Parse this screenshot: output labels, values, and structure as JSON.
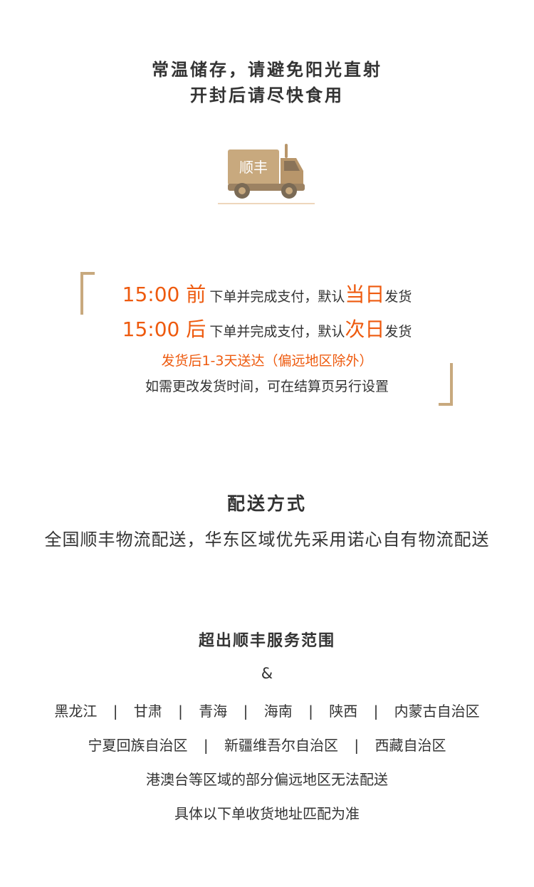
{
  "storage": {
    "line1": "常温储存，请避免阳光直射",
    "line2": "开封后请尽快食用"
  },
  "truck": {
    "label": "顺丰",
    "colors": {
      "body": "#c8a97e",
      "wheels": "#7a6a55",
      "line": "#e8c9a6"
    }
  },
  "shipping": {
    "before": {
      "time": "15:00 前",
      "text": "下单并完成支付，默认",
      "highlight": "当日",
      "suffix": "发货"
    },
    "after": {
      "time": "15:00 后",
      "text": "下单并完成支付，默认",
      "highlight": "次日",
      "suffix": "发货"
    },
    "delivery_range": "发货后1-3天送达（偏远地区除外）",
    "change_note": "如需更改发货时间，可在结算页另行设置"
  },
  "method": {
    "title": "配送方式",
    "description": "全国顺丰物流配送，华东区域优先采用诺心自有物流配送"
  },
  "out_of_range": {
    "title": "超出顺丰服务范围",
    "amp": "&",
    "regions_row1": [
      "黑龙江",
      "甘肃",
      "青海",
      "海南",
      "陕西",
      "内蒙古自治区"
    ],
    "regions_row2": [
      "宁夏回族自治区",
      "新疆维吾尔自治区",
      "西藏自治区"
    ],
    "separator": "|",
    "note1": "港澳台等区域的部分偏远地区无法配送",
    "note2": "具体以下单收货地址匹配为准"
  },
  "colors": {
    "accent_orange": "#ee5a0e",
    "bracket_gold": "#c8a97e",
    "text": "#333333"
  }
}
